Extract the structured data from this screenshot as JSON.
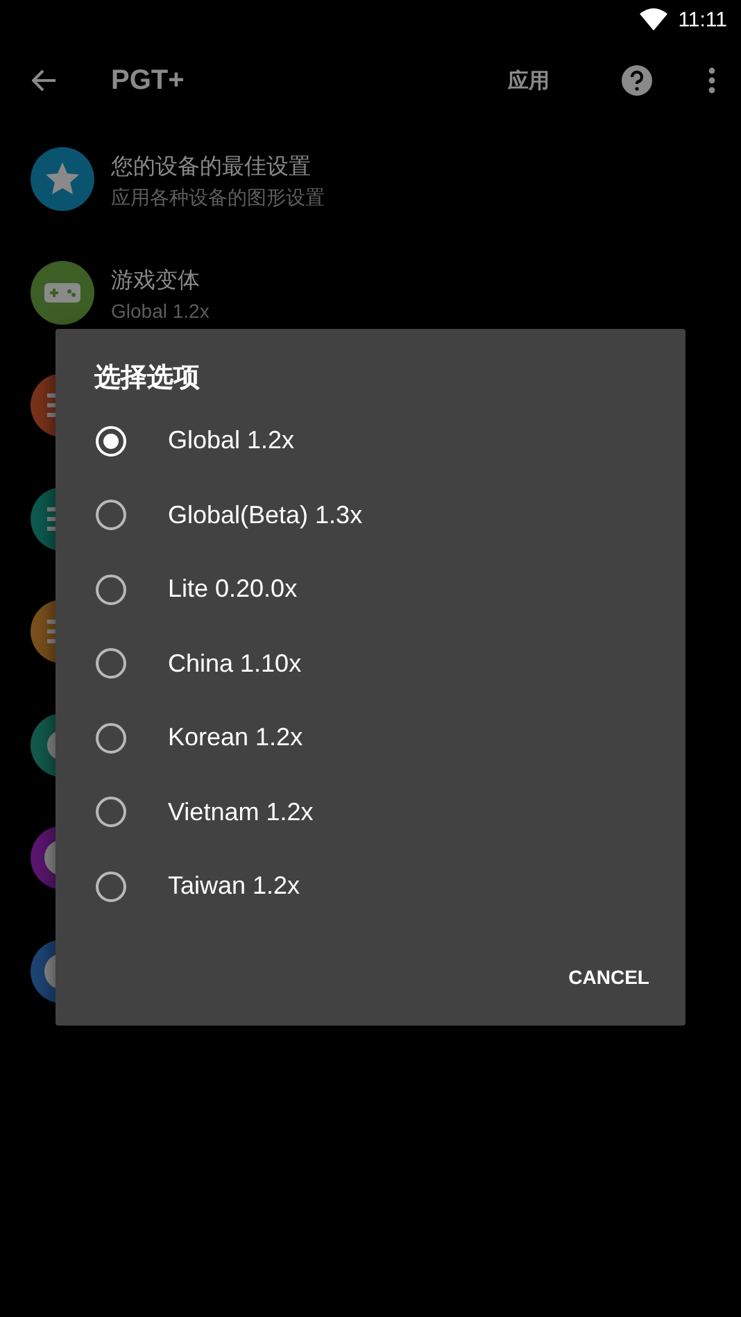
{
  "status_bar": {
    "time": "11:11"
  },
  "app_bar": {
    "title": "PGT+",
    "action": "应用"
  },
  "settings": [
    {
      "kind": "star",
      "color": "#0b5470",
      "title": "您的设备的最佳设置",
      "subtitle": "应用各种设备的图形设置"
    },
    {
      "kind": "gamepad",
      "color": "#3d5e24",
      "title": "游戏变体",
      "subtitle": "Global 1.2x"
    },
    {
      "kind": "sliders",
      "color": "#7a321a"
    },
    {
      "kind": "sliders",
      "color": "#0d5a4f"
    },
    {
      "kind": "sliders",
      "color": "#7a501c"
    },
    {
      "kind": "gear",
      "color": "#125a4d"
    },
    {
      "kind": "ring",
      "color": "#5a1670"
    },
    {
      "kind": "ring",
      "color": "#1d4475"
    }
  ],
  "dialog": {
    "title": "选择选项",
    "options": [
      {
        "label": "Global 1.2x",
        "selected": true
      },
      {
        "label": "Global(Beta) 1.3x",
        "selected": false
      },
      {
        "label": "Lite 0.20.0x",
        "selected": false
      },
      {
        "label": "China 1.10x",
        "selected": false
      },
      {
        "label": "Korean 1.2x",
        "selected": false
      },
      {
        "label": "Vietnam 1.2x",
        "selected": false
      },
      {
        "label": "Taiwan 1.2x",
        "selected": false
      }
    ],
    "button": "CANCEL"
  }
}
